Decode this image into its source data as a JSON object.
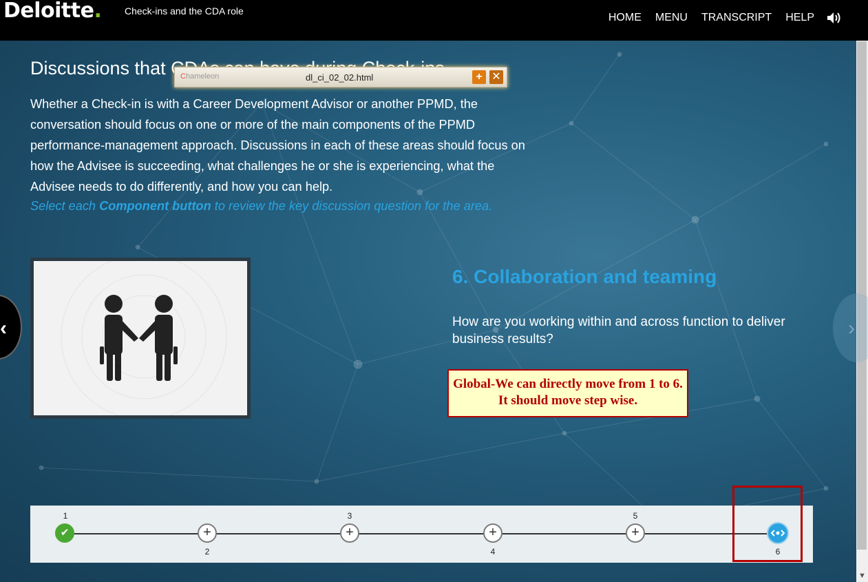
{
  "header": {
    "logo": "Deloitte",
    "logo_dot": ".",
    "course_title": "Check-ins and the CDA role",
    "nav": [
      "HOME",
      "MENU",
      "TRANSCRIPT",
      "HELP"
    ]
  },
  "popup": {
    "brand_c": "C",
    "brand_rest": "hameleon",
    "title": "dl_ci_02_02.html",
    "add_label": "+",
    "close_label": "✕"
  },
  "page": {
    "heading": "Discussions that CDAs can have during Check-ins",
    "paragraph": "Whether a Check-in is with a Career Development Advisor or another PPMD, the conversation should focus on one or more of the main components of the PPMD performance-management approach. Discussions in each of these areas should focus on how the Advisee is succeeding, what challenges he or she is experiencing, what the Advisee needs to do differently, and how you can help.",
    "instruction_pre": "Select each ",
    "instruction_bold": "Component button",
    "instruction_post": " to review the key discussion question for the area."
  },
  "component": {
    "title": "6. Collaboration and teaming",
    "question": "How are you working within and across function to deliver business results?"
  },
  "note": {
    "text": "Global-We can directly move from 1 to 6. It should move step wise."
  },
  "timeline": {
    "steps": [
      {
        "number": "1",
        "state": "done",
        "glyph": "✔"
      },
      {
        "number": "2",
        "state": "open",
        "glyph": "+"
      },
      {
        "number": "3",
        "state": "open",
        "glyph": "+"
      },
      {
        "number": "4",
        "state": "open",
        "glyph": "+"
      },
      {
        "number": "5",
        "state": "open",
        "glyph": "+"
      },
      {
        "number": "6",
        "state": "current",
        "glyph": ""
      }
    ]
  },
  "colors": {
    "accent": "#2aa3e0",
    "brand_green": "#86bc25",
    "annotation_red": "#b30000",
    "note_bg": "#ffffc8"
  },
  "icons": {
    "sound": "speaker-icon",
    "prev": "chevron-left-icon",
    "next": "chevron-right-icon",
    "current_step": "eye-icon"
  }
}
